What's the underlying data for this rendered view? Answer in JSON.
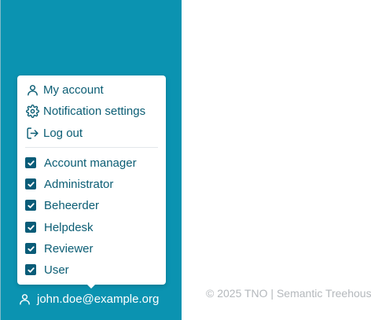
{
  "menu": {
    "actions": [
      {
        "label": "My account",
        "icon": "user-icon"
      },
      {
        "label": "Notification settings",
        "icon": "gear-icon"
      },
      {
        "label": "Log out",
        "icon": "log-out-icon"
      }
    ],
    "roles": [
      {
        "label": "Account manager",
        "checked": true
      },
      {
        "label": "Administrator",
        "checked": true
      },
      {
        "label": "Beheerder",
        "checked": true
      },
      {
        "label": "Helpdesk",
        "checked": true
      },
      {
        "label": "Reviewer",
        "checked": true
      },
      {
        "label": "User",
        "checked": true
      }
    ]
  },
  "user": {
    "email": "john.doe@example.org",
    "icon": "user-icon"
  },
  "footer": {
    "text": "© 2025 TNO | Semantic Treehouse"
  },
  "colors": {
    "sidebar": "#0b93b1",
    "menu_text": "#0b5d74",
    "checkbox": "#0a5c78",
    "footer_text": "#b4b8bc"
  }
}
